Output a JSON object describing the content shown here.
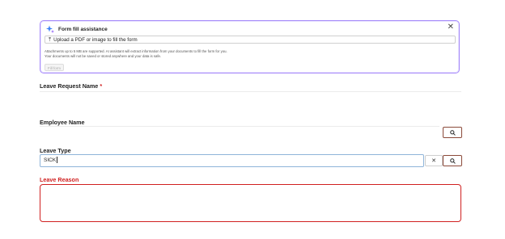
{
  "assist": {
    "title": "Form fill assistance",
    "upload_label": "Upload a PDF or image to fill the form",
    "note_line1": "Attachments up to 5 MB are supported. AI assistant will extract information from your documents to fill the form for you.",
    "note_line2": "Your documents will not be saved or stored anywhere and your data is safe.",
    "fill_button": "Fill form",
    "close_glyph": "✕",
    "upload_glyph": "⤒"
  },
  "fields": {
    "leave_request_name": {
      "label": "Leave Request Name",
      "required_mark": "*"
    },
    "employee_name": {
      "label": "Employee Name"
    },
    "leave_type": {
      "label": "Leave Type",
      "value": "SICK",
      "clear_glyph": "✕"
    },
    "leave_reason": {
      "label": "Leave Reason",
      "state": "invalid"
    }
  },
  "colors": {
    "assist_border": "#a78bfa",
    "error": "#d02020",
    "focus_border": "#8fb4d9",
    "lookup_button_border": "#8b4a3a"
  }
}
